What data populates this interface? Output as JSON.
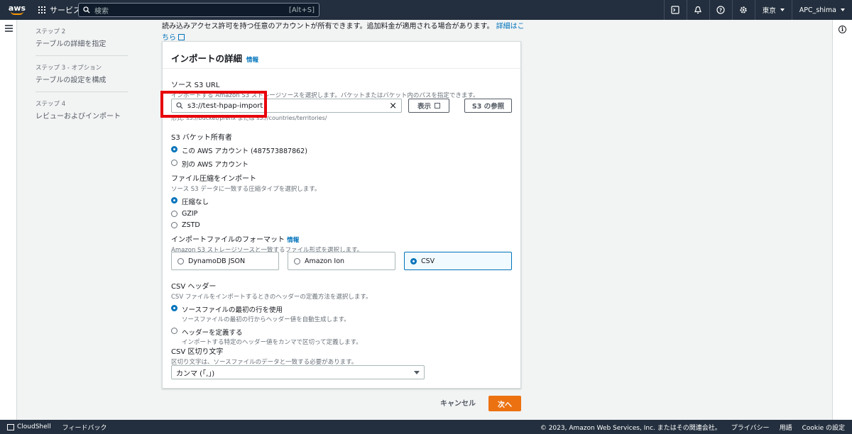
{
  "topnav": {
    "logo": "aws",
    "services_label": "サービス",
    "search_placeholder": "検索",
    "search_shortcut": "[Alt+S]",
    "region": "東京",
    "account": "APC_shima"
  },
  "steps": [
    {
      "num": "ステップ 2",
      "name": "テーブルの詳細を指定"
    },
    {
      "num": "ステップ 3 - オプション",
      "name": "テーブルの設定を構成"
    },
    {
      "num": "ステップ 4",
      "name": "レビューおよびインポート"
    }
  ],
  "intro": {
    "text": "読み込みアクセス許可を持つ任意のアカウントが所有できます。追加料金が適用される場合があります。",
    "link": "詳細はこちら"
  },
  "card": {
    "title": "インポートの詳細",
    "info": "情報",
    "s3": {
      "label": "ソース S3 URL",
      "desc": "インポートする Amazon S3 ストレージソースを選択します。バケットまたはバケット内のパスを指定できます。",
      "value": "s3://test-hpap-import",
      "view_button": "表示",
      "browse_button": "S3 の参照",
      "hint": "形式: s3://bucket/prefix または s3://countries/territories/"
    },
    "owner": {
      "label": "S3 バケット所有者",
      "options": [
        "この AWS アカウント (487573887862)",
        "別の AWS アカウント"
      ]
    },
    "compression": {
      "label": "ファイル圧縮をインポート",
      "desc": "ソース S3 データに一致する圧縮タイプを選択します。",
      "options": [
        "圧縮なし",
        "GZIP",
        "ZSTD"
      ]
    },
    "format": {
      "label": "インポートファイルのフォーマット",
      "info": "情報",
      "desc": "Amazon S3 ストレージソースと一致するファイル形式を選択します。",
      "options": [
        "DynamoDB JSON",
        "Amazon Ion",
        "CSV"
      ],
      "selected": "CSV"
    },
    "csv_header": {
      "label": "CSV ヘッダー",
      "desc": "CSV ファイルをインポートするときのヘッダーの定義方法を選択します。",
      "options": [
        {
          "title": "ソースファイルの最初の行を使用",
          "sub": "ソースファイルの最初の行からヘッダー値を自動生成します。"
        },
        {
          "title": "ヘッダーを定義する",
          "sub": "インポートする特定のヘッダー値をカンマで区切って定義します。"
        }
      ]
    },
    "delimiter": {
      "label": "CSV 区切り文字",
      "desc": "区切り文字は、ソースファイルのデータと一致する必要があります。",
      "value": "カンマ (「,」)"
    }
  },
  "actions": {
    "cancel": "キャンセル",
    "next": "次へ"
  },
  "footer": {
    "cloudshell": "CloudShell",
    "feedback": "フィードバック",
    "copyright": "© 2023, Amazon Web Services, Inc. またはその関連会社。",
    "privacy": "プライバシー",
    "terms": "用語",
    "cookie": "Cookie の設定"
  },
  "colors": {
    "nav": "#232f3e",
    "accent": "#0073bb",
    "primary_button": "#ec7211",
    "highlight_box": "#e8000b"
  }
}
